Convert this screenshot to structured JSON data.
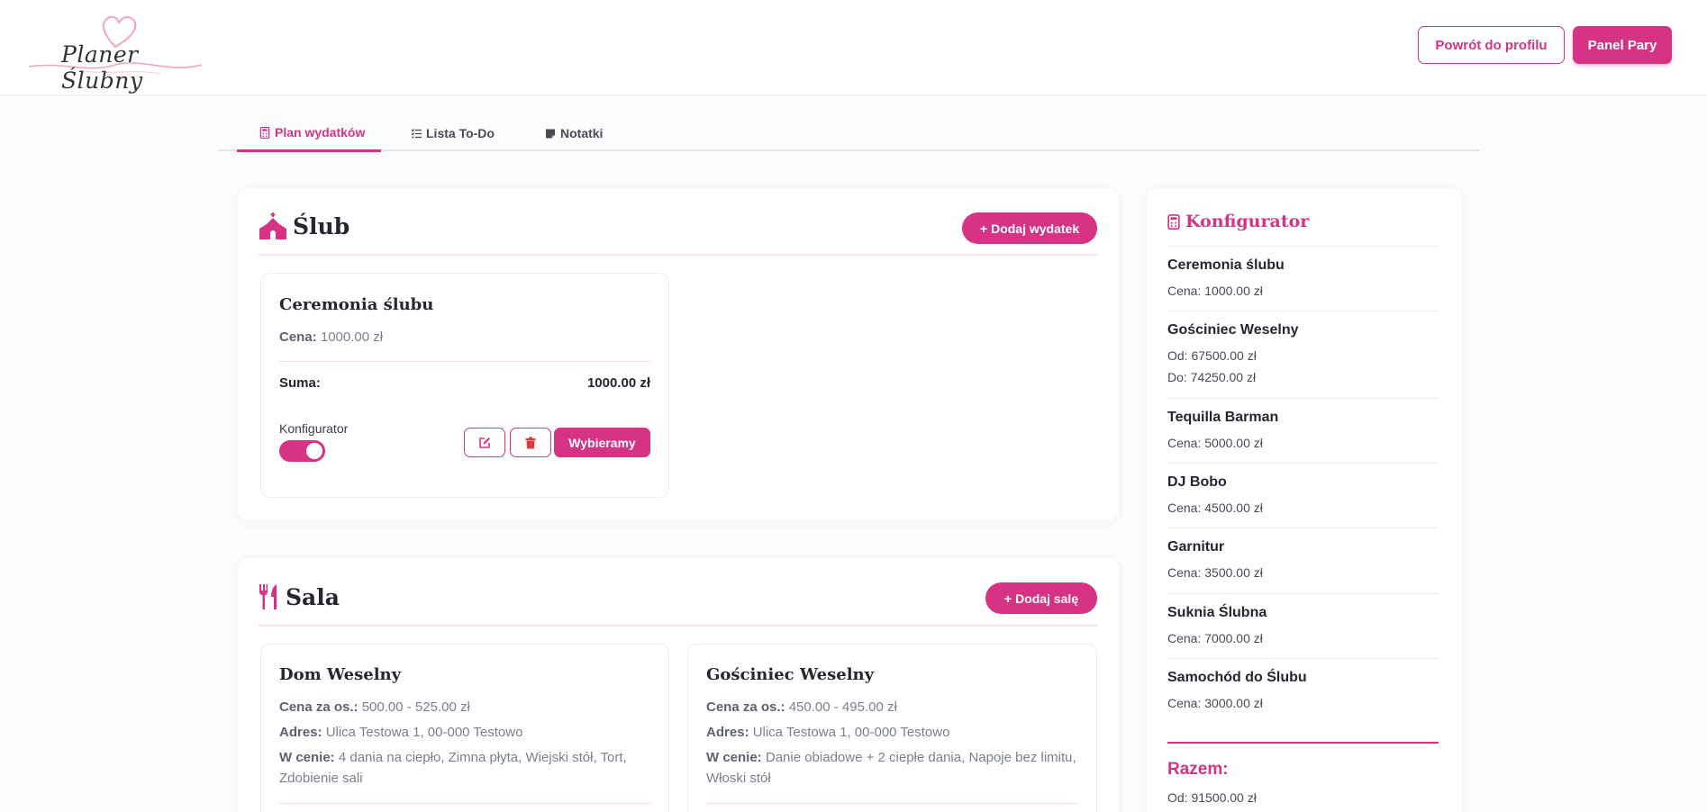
{
  "header": {
    "logo_text": "Planer Ślubny",
    "back_button": "Powrót do profilu",
    "panel_button": "Panel Pary"
  },
  "tabs": [
    {
      "label": "Plan wydatków",
      "icon": "calculator-icon",
      "active": true
    },
    {
      "label": "Lista To-Do",
      "icon": "checklist-icon",
      "active": false
    },
    {
      "label": "Notatki",
      "icon": "sticky-note-icon",
      "active": false
    }
  ],
  "colors": {
    "accent": "#d63384"
  },
  "slub": {
    "title": "Ślub",
    "icon": "church-icon",
    "add_button": "Dodaj wydatek",
    "items": [
      {
        "title": "Ceremonia ślubu",
        "price_label": "Cena:",
        "price_value": "1000.00 zł",
        "sum_label": "Suma:",
        "sum_value": "1000.00 zł",
        "toggle_label": "Konfigurator",
        "toggle_on": true,
        "choose_button": "Wybieramy"
      }
    ]
  },
  "sala": {
    "title": "Sala",
    "icon": "utensils-icon",
    "add_button": "Dodaj salę",
    "items": [
      {
        "title": "Dom Weselny",
        "price_label": "Cena za os.:",
        "price_value": "500.00 - 525.00 zł",
        "address_label": "Adres:",
        "address_value": "Ulica Testowa 1, 00-000 Testowo",
        "includes_label": "W cenie:",
        "includes_value": "4 dania na ciepło, Zimna płyta, Wiejski stół, Tort, Zdobienie sali"
      },
      {
        "title": "Gościniec Weselny",
        "price_label": "Cena za os.:",
        "price_value": "450.00 - 495.00 zł",
        "address_label": "Adres:",
        "address_value": "Ulica Testowa 1, 00-000 Testowo",
        "includes_label": "W cenie:",
        "includes_value": "Danie obiadowe + 2 ciepłe dania, Napoje bez limitu, Włoski stół"
      }
    ]
  },
  "configurator": {
    "title": "Konfigurator",
    "items": [
      {
        "name": "Ceremonia ślubu",
        "lines": [
          "Cena: 1000.00 zł"
        ]
      },
      {
        "name": "Gościniec Weselny",
        "lines": [
          "Od: 67500.00 zł",
          "Do: 74250.00 zł"
        ]
      },
      {
        "name": "Tequilla Barman",
        "lines": [
          "Cena: 5000.00 zł"
        ]
      },
      {
        "name": "DJ Bobo",
        "lines": [
          "Cena: 4500.00 zł"
        ]
      },
      {
        "name": "Garnitur",
        "lines": [
          "Cena: 3500.00 zł"
        ]
      },
      {
        "name": "Suknia Ślubna",
        "lines": [
          "Cena: 7000.00 zł"
        ]
      },
      {
        "name": "Samochód do Ślubu",
        "lines": [
          "Cena: 3000.00 zł"
        ]
      }
    ],
    "total_label": "Razem:",
    "total_from": "Od: 91500.00 zł"
  }
}
